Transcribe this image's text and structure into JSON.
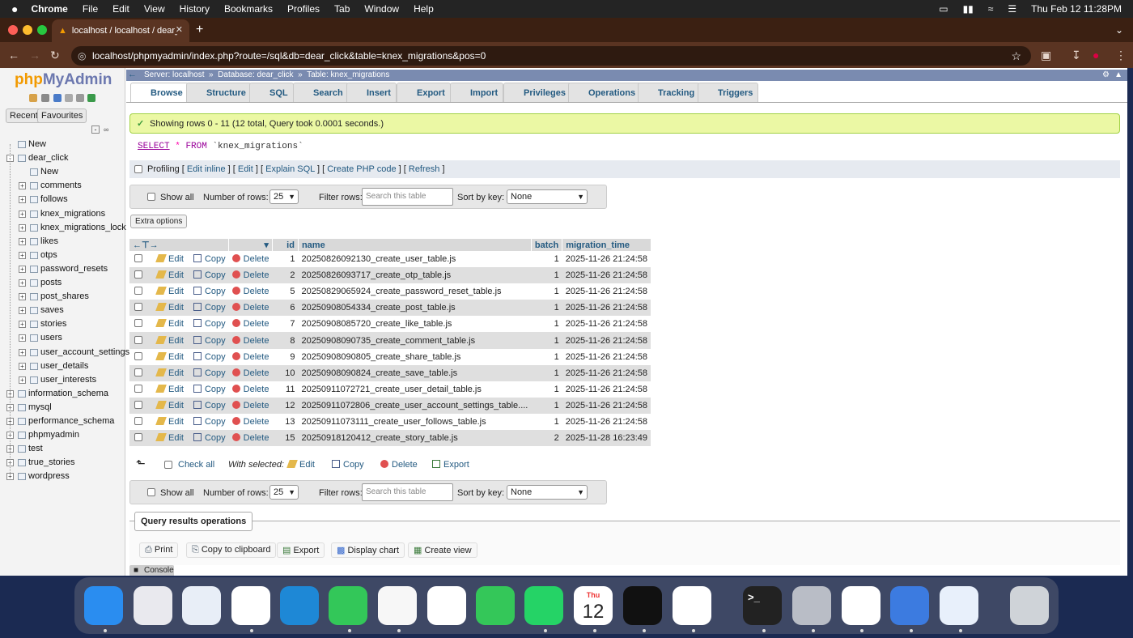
{
  "menubar": {
    "app": "Chrome",
    "items": [
      "File",
      "Edit",
      "View",
      "History",
      "Bookmarks",
      "Profiles",
      "Tab",
      "Window",
      "Help"
    ],
    "clock": "Thu Feb 12  11:28PM"
  },
  "browser": {
    "tab_title": "localhost / localhost / dear_cli",
    "url": "localhost/phpmyadmin/index.php?route=/sql&db=dear_click&table=knex_migrations&pos=0"
  },
  "sidebar": {
    "logo_php": "php",
    "logo_myadmin": "MyAdmin",
    "tabs": [
      "Recent",
      "Favourites"
    ],
    "tree": [
      {
        "label": "New",
        "level": 0
      },
      {
        "label": "dear_click",
        "level": 0
      },
      {
        "label": "New",
        "level": 1
      },
      {
        "label": "comments",
        "level": 1
      },
      {
        "label": "follows",
        "level": 1
      },
      {
        "label": "knex_migrations",
        "level": 1
      },
      {
        "label": "knex_migrations_lock",
        "level": 1
      },
      {
        "label": "likes",
        "level": 1
      },
      {
        "label": "otps",
        "level": 1
      },
      {
        "label": "password_resets",
        "level": 1
      },
      {
        "label": "posts",
        "level": 1
      },
      {
        "label": "post_shares",
        "level": 1
      },
      {
        "label": "saves",
        "level": 1
      },
      {
        "label": "stories",
        "level": 1
      },
      {
        "label": "users",
        "level": 1
      },
      {
        "label": "user_account_settings",
        "level": 1
      },
      {
        "label": "user_details",
        "level": 1
      },
      {
        "label": "user_interests",
        "level": 1
      },
      {
        "label": "information_schema",
        "level": 0
      },
      {
        "label": "mysql",
        "level": 0
      },
      {
        "label": "performance_schema",
        "level": 0
      },
      {
        "label": "phpmyadmin",
        "level": 0
      },
      {
        "label": "test",
        "level": 0
      },
      {
        "label": "true_stories",
        "level": 0
      },
      {
        "label": "wordpress",
        "level": 0
      }
    ]
  },
  "breadcrumb": {
    "server": "Server: localhost",
    "database": "Database: dear_click",
    "table": "Table: knex_migrations"
  },
  "tabs": [
    "Browse",
    "Structure",
    "SQL",
    "Search",
    "Insert",
    "Export",
    "Import",
    "Privileges",
    "Operations",
    "Tracking",
    "Triggers"
  ],
  "success_message": "Showing rows 0 - 11 (12 total, Query took 0.0001 seconds.)",
  "sql": {
    "kw1": "SELECT",
    "star": "*",
    "kw2": "FROM",
    "table": "`knex_migrations`"
  },
  "profiling": {
    "label": "Profiling",
    "links": [
      "Edit inline",
      "Edit",
      "Explain SQL",
      "Create PHP code",
      "Refresh"
    ]
  },
  "filter": {
    "show_all": "Show all",
    "num_rows_label": "Number of rows:",
    "num_rows_value": "25",
    "filter_label": "Filter rows:",
    "filter_placeholder": "Search this table",
    "sort_label": "Sort by key:",
    "sort_value": "None"
  },
  "extra_options": "Extra options",
  "columns": [
    "id",
    "name",
    "batch",
    "migration_time"
  ],
  "actions": {
    "edit": "Edit",
    "copy": "Copy",
    "delete": "Delete"
  },
  "rows": [
    {
      "id": "1",
      "name": "20250826092130_create_user_table.js",
      "batch": "1",
      "time": "2025-11-26 21:24:58"
    },
    {
      "id": "2",
      "name": "20250826093717_create_otp_table.js",
      "batch": "1",
      "time": "2025-11-26 21:24:58"
    },
    {
      "id": "5",
      "name": "20250829065924_create_password_reset_table.js",
      "batch": "1",
      "time": "2025-11-26 21:24:58"
    },
    {
      "id": "6",
      "name": "20250908054334_create_post_table.js",
      "batch": "1",
      "time": "2025-11-26 21:24:58"
    },
    {
      "id": "7",
      "name": "20250908085720_create_like_table.js",
      "batch": "1",
      "time": "2025-11-26 21:24:58"
    },
    {
      "id": "8",
      "name": "20250908090735_create_comment_table.js",
      "batch": "1",
      "time": "2025-11-26 21:24:58"
    },
    {
      "id": "9",
      "name": "20250908090805_create_share_table.js",
      "batch": "1",
      "time": "2025-11-26 21:24:58"
    },
    {
      "id": "10",
      "name": "20250908090824_create_save_table.js",
      "batch": "1",
      "time": "2025-11-26 21:24:58"
    },
    {
      "id": "11",
      "name": "20250911072721_create_user_detail_table.js",
      "batch": "1",
      "time": "2025-11-26 21:24:58"
    },
    {
      "id": "12",
      "name": "20250911072806_create_user_account_settings_table....",
      "batch": "1",
      "time": "2025-11-26 21:24:58"
    },
    {
      "id": "13",
      "name": "20250911073111_create_user_follows_table.js",
      "batch": "1",
      "time": "2025-11-26 21:24:58"
    },
    {
      "id": "15",
      "name": "20250918120412_create_story_table.js",
      "batch": "2",
      "time": "2025-11-28 16:23:49"
    }
  ],
  "with_selected": {
    "check_all": "Check all",
    "label": "With selected:",
    "edit": "Edit",
    "copy": "Copy",
    "delete": "Delete",
    "export": "Export"
  },
  "query_ops": {
    "title": "Query results operations",
    "items": [
      "Print",
      "Copy to clipboard",
      "Export",
      "Display chart",
      "Create view"
    ]
  },
  "console": "Console",
  "dock": [
    {
      "name": "finder-icon",
      "color": "#2a8df0"
    },
    {
      "name": "launchpad-icon",
      "color": "#e9e9ee"
    },
    {
      "name": "safari-icon",
      "color": "#e8eef7"
    },
    {
      "name": "chrome-icon",
      "color": "#ffffff"
    },
    {
      "name": "vscode-icon",
      "color": "#1e88d6"
    },
    {
      "name": "messages-icon",
      "color": "#33c759"
    },
    {
      "name": "photos-icon",
      "color": "#f7f7f7"
    },
    {
      "name": "netflix-icon",
      "color": "#ffffff"
    },
    {
      "name": "facetime-icon",
      "color": "#34c759"
    },
    {
      "name": "whatsapp-icon",
      "color": "#25d366"
    },
    {
      "name": "calendar-icon",
      "color": "#ffffff"
    },
    {
      "name": "spotify-icon",
      "color": "#111111"
    },
    {
      "name": "youtube-icon",
      "color": "#ffffff"
    },
    {
      "name": "terminal-icon",
      "color": "#222222"
    },
    {
      "name": "system-settings-icon",
      "color": "#b9bdc6"
    },
    {
      "name": "slack-icon",
      "color": "#ffffff"
    },
    {
      "name": "preview-icon",
      "color": "#3c7be0"
    },
    {
      "name": "quicktime-icon",
      "color": "#e8f0fb"
    },
    {
      "name": "trash-icon",
      "color": "#cfd3d8"
    }
  ],
  "dock_calendar": {
    "month": "Thu",
    "day": "12"
  },
  "dock_terminal": ">_"
}
